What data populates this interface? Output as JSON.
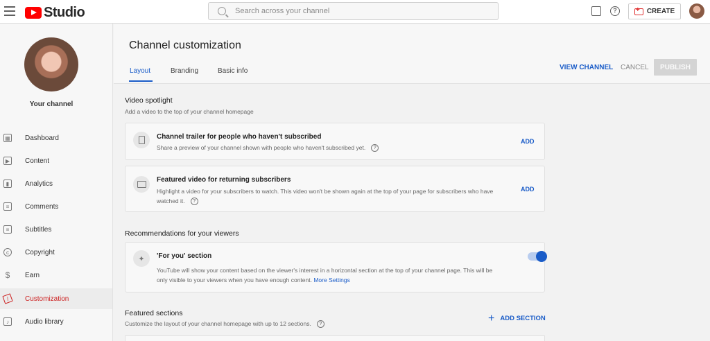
{
  "app": {
    "name": "Studio"
  },
  "search": {
    "placeholder": "Search across your channel"
  },
  "header": {
    "create_label": "CREATE"
  },
  "sidebar": {
    "channel_label": "Your channel",
    "items": [
      {
        "label": "Dashboard",
        "icon": "dashboard-icon"
      },
      {
        "label": "Content",
        "icon": "content-icon"
      },
      {
        "label": "Analytics",
        "icon": "analytics-icon"
      },
      {
        "label": "Comments",
        "icon": "comments-icon"
      },
      {
        "label": "Subtitles",
        "icon": "subtitles-icon"
      },
      {
        "label": "Copyright",
        "icon": "copyright-icon"
      },
      {
        "label": "Earn",
        "icon": "dollar-icon"
      },
      {
        "label": "Customization",
        "icon": "wand-icon",
        "active": true
      },
      {
        "label": "Audio library",
        "icon": "audio-library-icon"
      }
    ]
  },
  "page": {
    "title": "Channel customization",
    "tabs": [
      {
        "label": "Layout",
        "active": true
      },
      {
        "label": "Branding"
      },
      {
        "label": "Basic info"
      }
    ],
    "actions": {
      "view_channel": "VIEW CHANNEL",
      "cancel": "CANCEL",
      "publish": "PUBLISH"
    }
  },
  "video_spotlight": {
    "title": "Video spotlight",
    "subtitle": "Add a video to the top of your channel homepage",
    "cards": [
      {
        "title": "Channel trailer for people who haven't subscribed",
        "desc": "Share a preview of your channel shown with people who haven't subscribed yet.",
        "action": "ADD"
      },
      {
        "title": "Featured video for returning subscribers",
        "desc_line1": "Highlight a video for your subscribers to watch. This video won't be shown again at the top of your page for subscribers who have",
        "desc_line2": "watched it.",
        "action": "ADD"
      }
    ]
  },
  "recommendations": {
    "title": "Recommendations for your viewers",
    "card": {
      "title": "'For you' section",
      "desc_line1": "YouTube will show your content based on the viewer's interest in a horizontal section at the top of your channel page. This will be",
      "desc_line2": "only visible to your viewers when you have enough content.",
      "link": "More Settings",
      "toggle_on": true
    }
  },
  "featured_sections": {
    "title": "Featured sections",
    "subtitle": "Customize the layout of your channel homepage with up to 12 sections.",
    "add_label": "ADD SECTION"
  },
  "colors": {
    "accent": "#1a5cc8",
    "active_nav": "#cc2020",
    "brand_red": "#ff0000"
  }
}
